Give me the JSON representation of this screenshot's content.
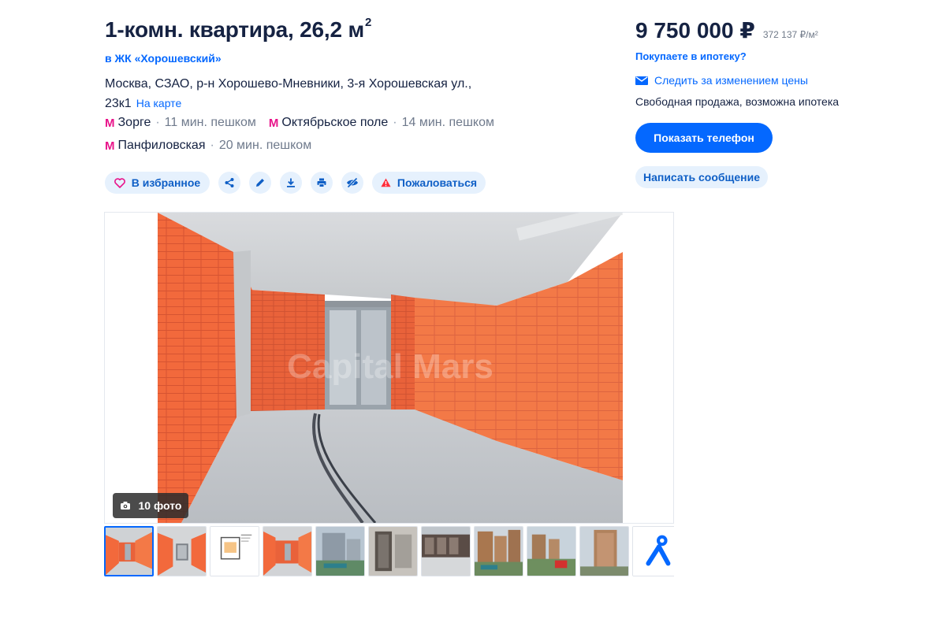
{
  "listing": {
    "title": "1-комн. квартира, 26,2 м",
    "title_sup": "2",
    "complex_link": "в ЖК «Хорошевский»",
    "address": "Москва, СЗАО, р-н Хорошево-Мневники, 3-я Хорошевская ул., 23к1",
    "map_link": "На карте"
  },
  "metro": [
    {
      "icon": "М",
      "name": "Зорге",
      "sep": "·",
      "time": "11 мин. пешком"
    },
    {
      "icon": "М",
      "name": "Октябрьское поле",
      "sep": "·",
      "time": "14 мин. пешком"
    },
    {
      "icon": "М",
      "name": "Панфиловская",
      "sep": "·",
      "time": "20 мин. пешком"
    }
  ],
  "actions": {
    "favorite": "В избранное",
    "report": "Пожаловаться"
  },
  "gallery": {
    "watermark": "Capital Mars",
    "photo_count_label": "10 фото",
    "thumbnails": [
      "photo-1",
      "photo-2",
      "floor-plan",
      "photo-4",
      "photo-5",
      "photo-6",
      "photo-7",
      "photo-8",
      "photo-9",
      "photo-10",
      "map-pin"
    ],
    "active_index": 0
  },
  "sidebar": {
    "price": "9 750 000 ₽",
    "price_per_m2": "372 137 ₽/м²",
    "mortgage_link": "Покупаете в ипотеку?",
    "watch_price": "Следить за изменением цены",
    "sale_info": "Свободная продажа, возможна ипотека",
    "show_phone": "Показать телефон",
    "send_message": "Написать сообщение"
  },
  "colors": {
    "accent": "#0468ff",
    "pill_bg": "#e6f1fd",
    "metro": "#e8138a",
    "text": "#152242",
    "muted": "#6f7a8c",
    "report": "#ff2d3a"
  }
}
